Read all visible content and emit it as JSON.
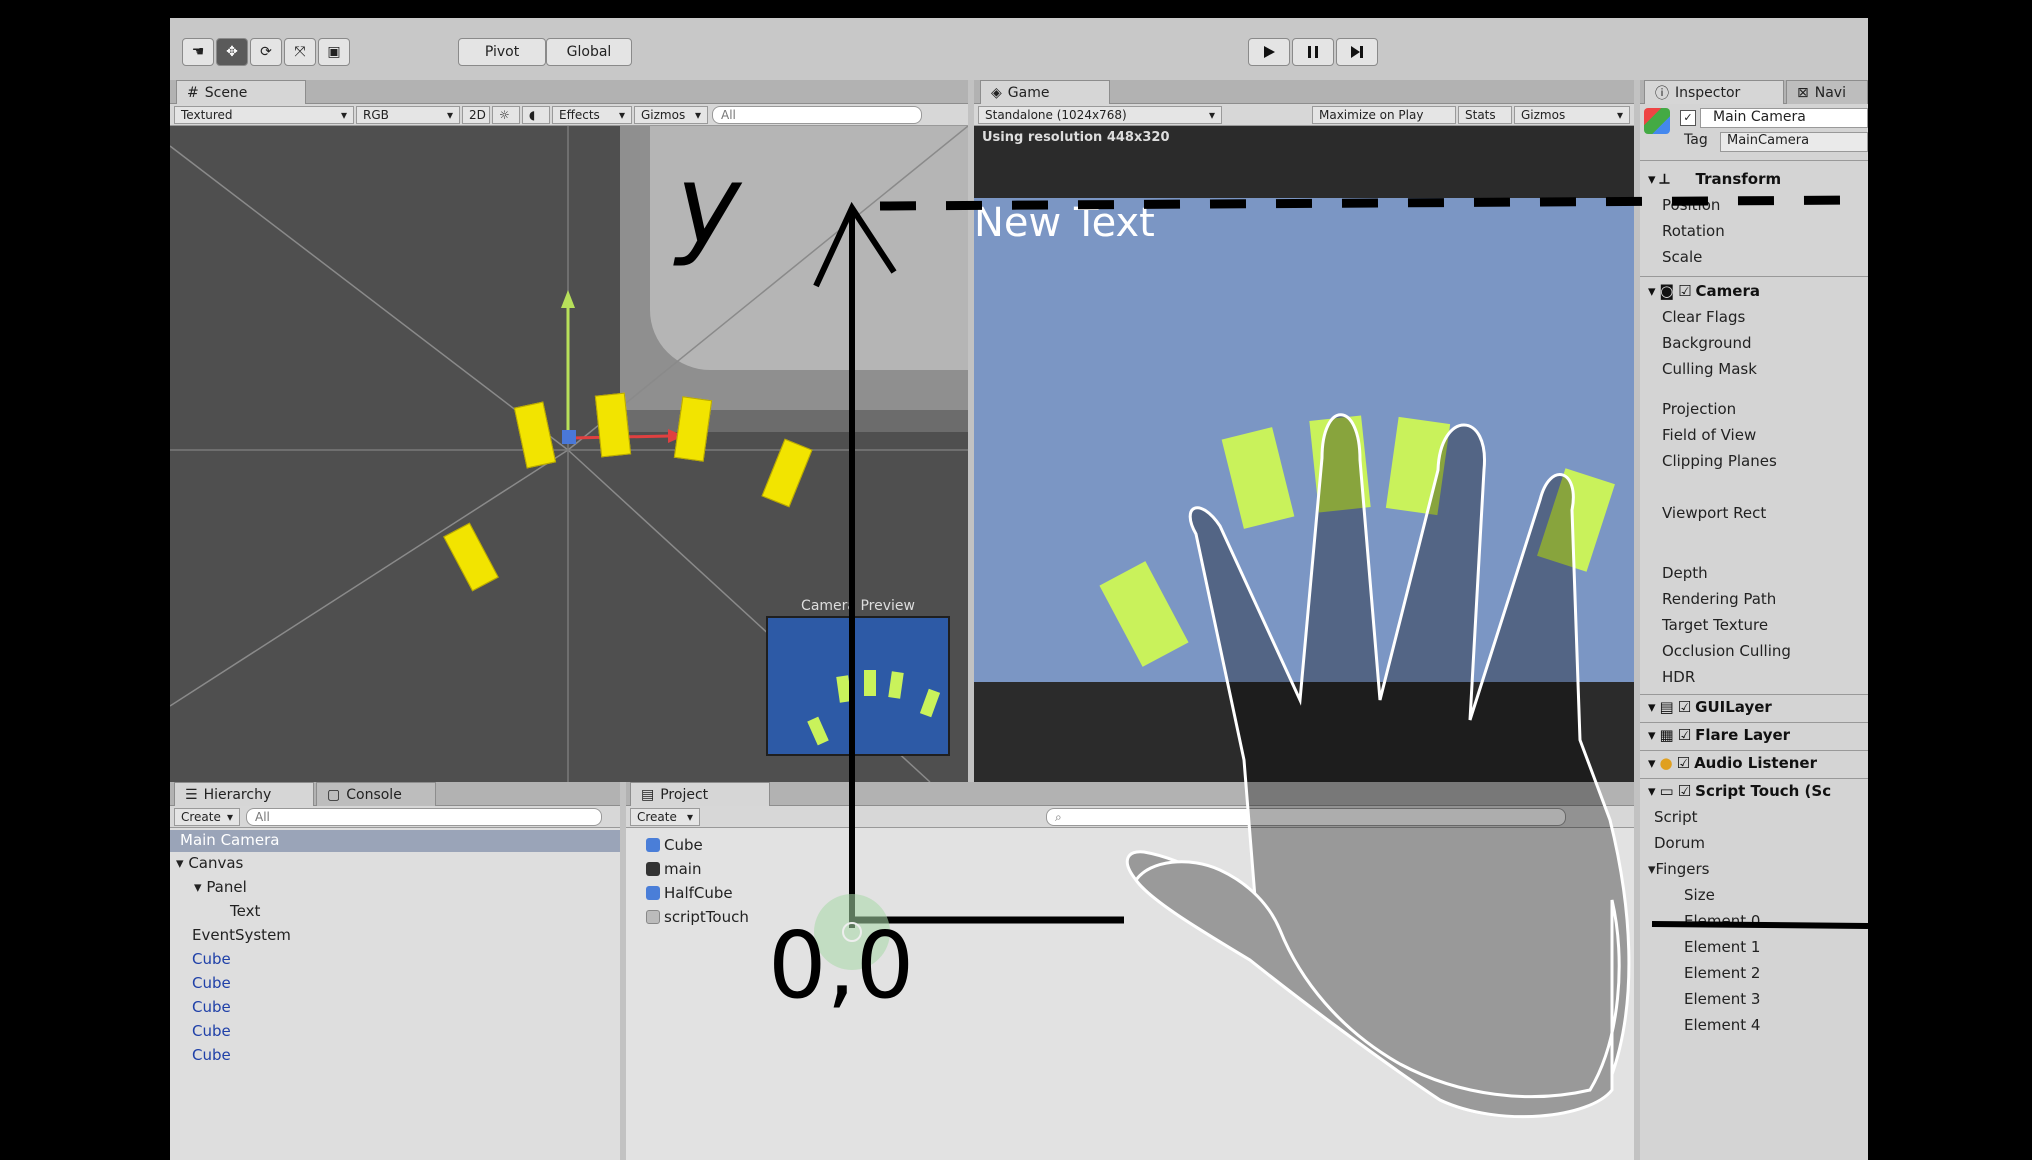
{
  "toolbar": {
    "pivot_label": "Pivot",
    "global_label": "Global",
    "play_icon": "play-icon",
    "pause_icon": "pause-icon",
    "step_icon": "step-icon"
  },
  "scene": {
    "tab_label": "Scene",
    "shading": "Textured",
    "render_mode": "RGB",
    "mode_2d": "2D",
    "effects": "Effects",
    "gizmos": "Gizmos",
    "search_placeholder": "All",
    "camera_preview": "Camera Preview"
  },
  "game": {
    "tab_label": "Game",
    "resolution_select": "Standalone (1024x768)",
    "maximize": "Maximize on Play",
    "stats": "Stats",
    "gizmos": "Gizmos",
    "resolution_note": "Using resolution 448x320",
    "ui_text": "New Text"
  },
  "inspector": {
    "tab_label": "Inspector",
    "tab2_label": "Navi",
    "object_name": "Main Camera",
    "tag_label": "Tag",
    "tag_value": "MainCamera",
    "transform": {
      "title": "Transform",
      "rows": [
        "Position",
        "Rotation",
        "Scale"
      ]
    },
    "camera": {
      "title": "Camera",
      "rows_a": [
        "Clear Flags",
        "Background",
        "Culling Mask"
      ],
      "rows_b": [
        "Projection",
        "Field of View",
        "Clipping Planes"
      ],
      "rows_c": [
        "Viewport Rect"
      ],
      "rows_d": [
        "Depth",
        "Rendering Path",
        "Target Texture",
        "Occlusion Culling",
        "HDR"
      ]
    },
    "components": [
      "GUILayer",
      "Flare Layer",
      "Audio Listener",
      "Script Touch (Sc"
    ],
    "script_rows": [
      "Script",
      "Dorum"
    ],
    "fingers_label": "Fingers",
    "size_label": "Size",
    "elements": [
      "Element 0",
      "Element 1",
      "Element 2",
      "Element 3",
      "Element 4"
    ]
  },
  "hierarchy": {
    "tab_label": "Hierarchy",
    "console_label": "Console",
    "create_label": "Create",
    "search_placeholder": "All",
    "items": [
      {
        "label": "Main Camera",
        "indent": 0
      },
      {
        "label": "Canvas",
        "indent": 0
      },
      {
        "label": "Panel",
        "indent": 1
      },
      {
        "label": "Text",
        "indent": 2
      },
      {
        "label": "EventSystem",
        "indent": 0
      },
      {
        "label": "Cube",
        "indent": 0
      },
      {
        "label": "Cube",
        "indent": 0
      },
      {
        "label": "Cube",
        "indent": 0
      },
      {
        "label": "Cube",
        "indent": 0
      },
      {
        "label": "Cube",
        "indent": 0
      }
    ]
  },
  "project": {
    "tab_label": "Project",
    "create_label": "Create",
    "assets": [
      "Cube",
      "main",
      "HalfCube",
      "scriptTouch"
    ]
  },
  "annotation": {
    "y_label": "y",
    "origin_label": "0,0"
  },
  "colors": {
    "cube_yellow": "#f2e400",
    "game_cube_green": "#c9f25b",
    "game_sky": "#7b96c4",
    "preview_blue": "#2d5aa6"
  }
}
